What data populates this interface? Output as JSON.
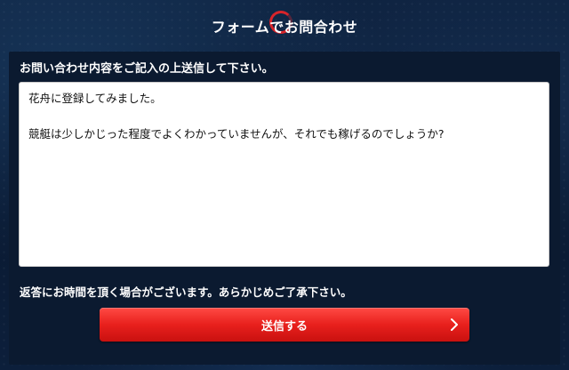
{
  "header": {
    "title": "フォームでお問合わせ"
  },
  "form": {
    "instructions": "お問い合わせ内容をご記入の上送信して下さい。",
    "message_lines": [
      "花舟に登録してみました。",
      "",
      "競艇は少しかじった程度でよくわかっていませんが、それでも稼げるのでしょうか?"
    ],
    "reply_note": "返答にお時間を頂く場合がございます。あらかじめご了承下さい。",
    "submit_label": "送信する"
  },
  "colors": {
    "background": "#0b1b34",
    "accent_red": "#e8201d",
    "ring_red": "#d8242a"
  },
  "icons": {
    "submit": "chevron-right-icon",
    "title_decoration": "ring-icon"
  }
}
